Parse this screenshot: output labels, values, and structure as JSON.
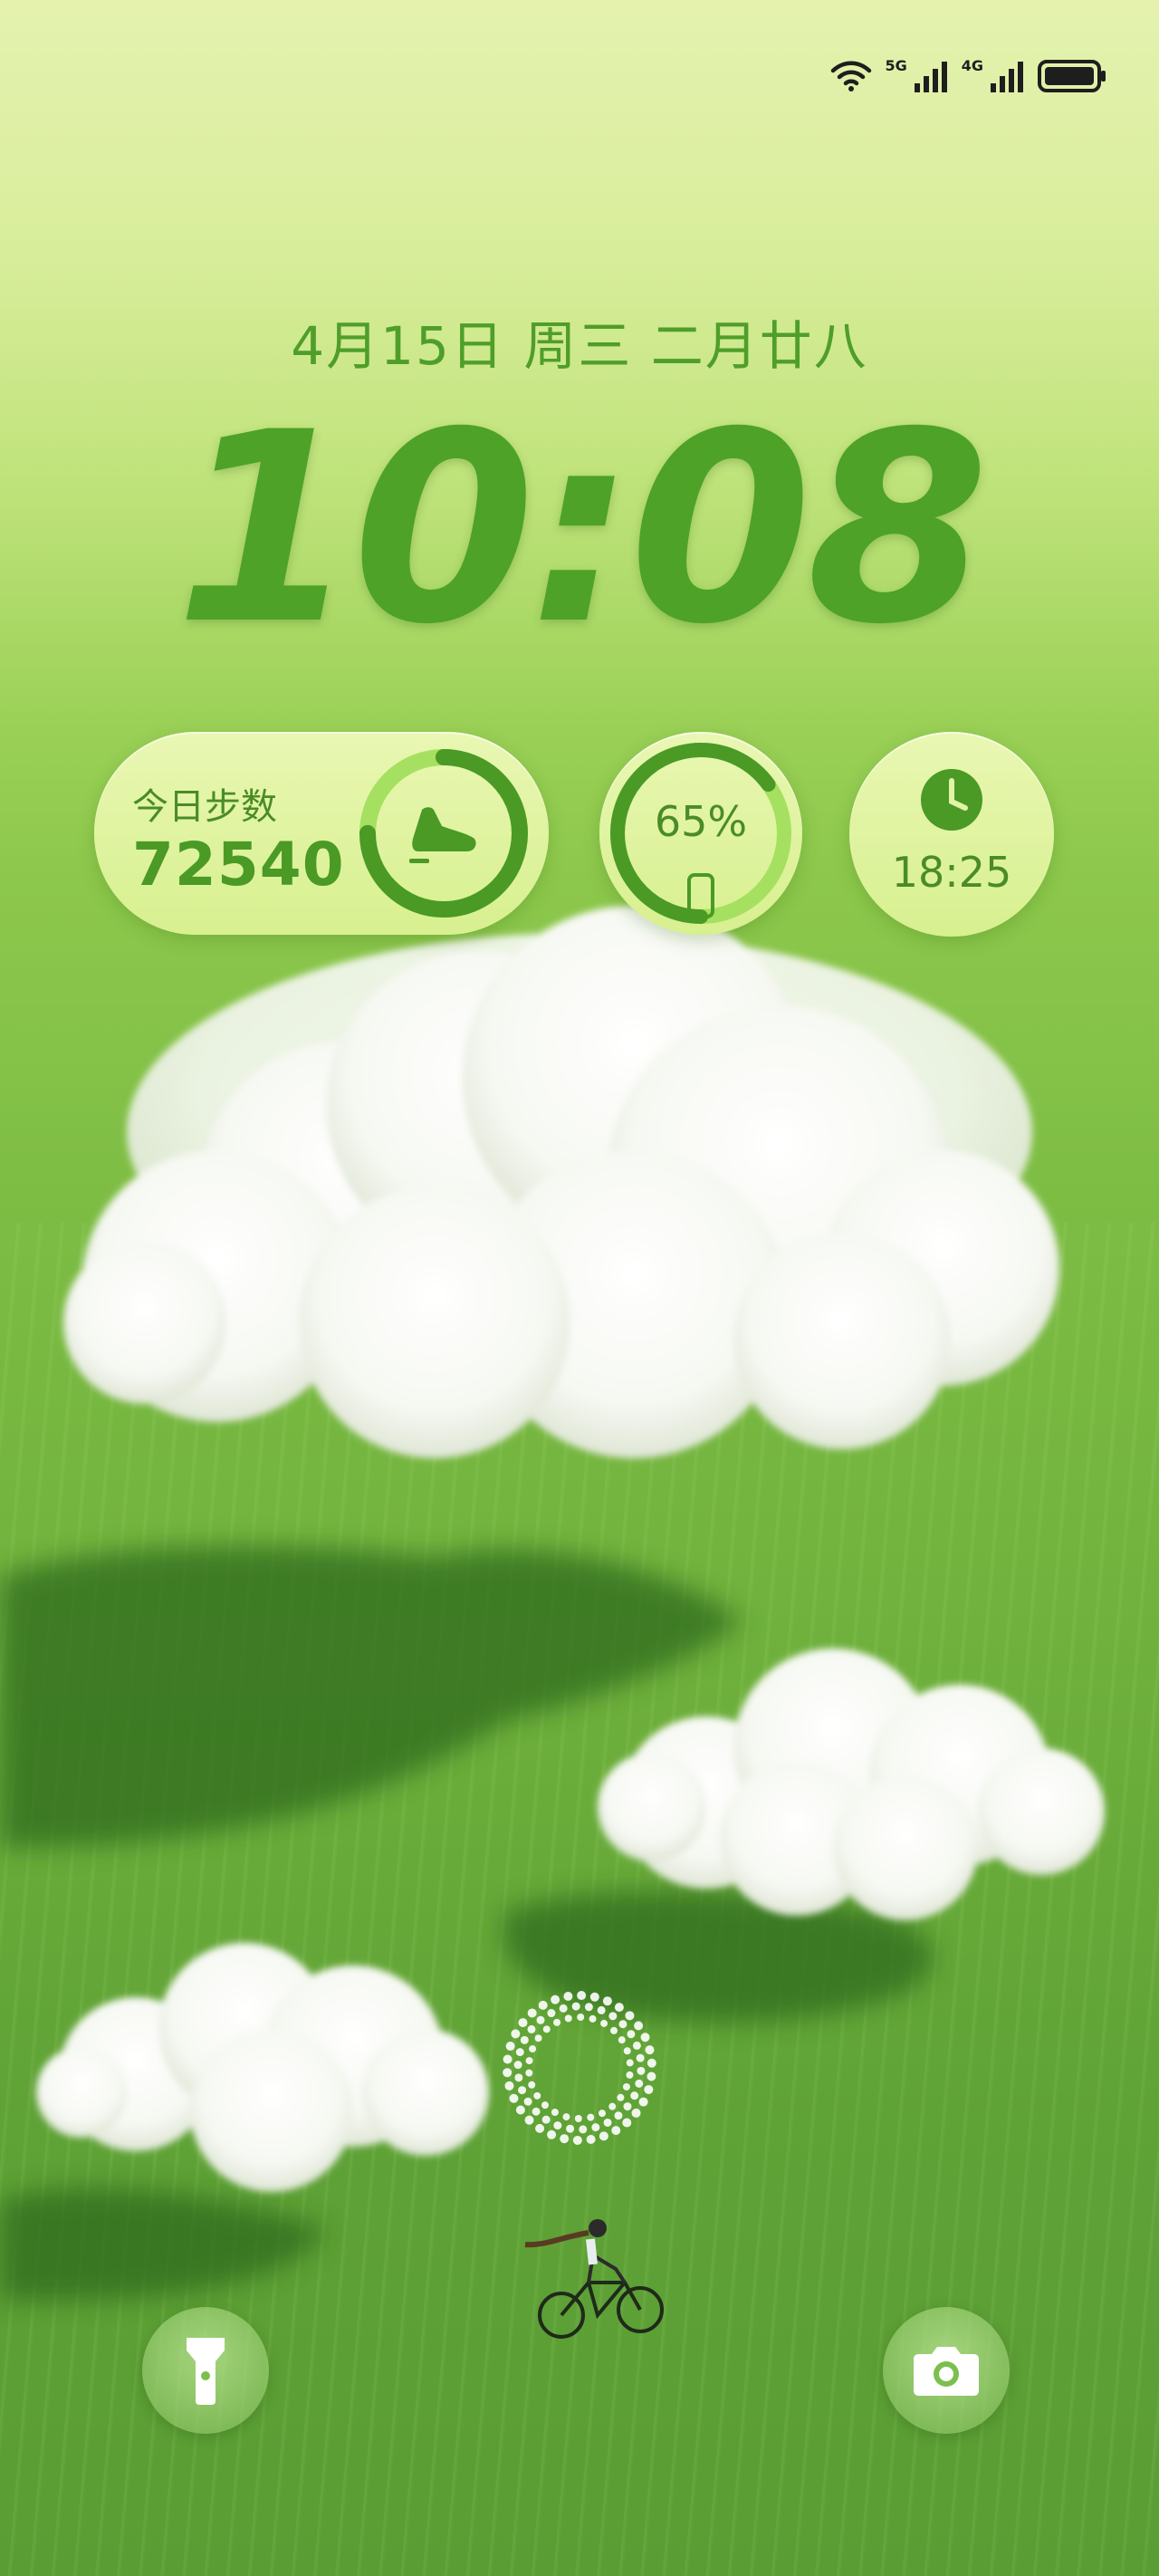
{
  "status_bar": {
    "wifi_icon": "wifi-icon",
    "network_1": "5G",
    "network_2": "4G",
    "battery_icon": "battery-icon"
  },
  "lockscreen": {
    "date": "4月15日 周三 二月廿八",
    "time": "10:08"
  },
  "widgets": {
    "steps": {
      "label": "今日步数",
      "value": "72540",
      "icon": "shoe-icon",
      "progress": 0.75
    },
    "battery": {
      "value": "65%",
      "icon": "phone-icon",
      "progress": 0.65
    },
    "clock": {
      "icon": "clock-icon",
      "value": "18:25"
    }
  },
  "shortcuts": {
    "left": "flashlight-icon",
    "right": "camera-icon"
  },
  "colors": {
    "accent_green": "#4ea227",
    "widget_bg": "#e2f4a6",
    "ring_dark": "#4a9a25",
    "ring_light": "#9fdc5a"
  }
}
